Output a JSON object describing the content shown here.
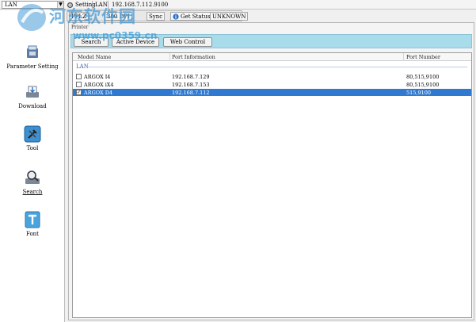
{
  "topbar": {
    "port_selected": "LAN",
    "setting_label": "Setting",
    "connection_type": "LAN",
    "ip_address": "192.168.7.112.9100"
  },
  "toolbar2": {
    "port_label": "PPLZ",
    "dpi_label": "300 DPI",
    "sync_label": "Sync",
    "get_status_label": "Get Status",
    "status_value": "UNKNOWN"
  },
  "sidebar": {
    "items": [
      {
        "label": "Parameter Setting",
        "icon": "parameter-setting-icon"
      },
      {
        "label": "Download",
        "icon": "download-icon"
      },
      {
        "label": "Tool",
        "icon": "tool-icon"
      },
      {
        "label": "Search",
        "icon": "search-icon"
      },
      {
        "label": "Font",
        "icon": "font-icon"
      }
    ]
  },
  "main": {
    "group_label": "Printer",
    "buttons": {
      "search": "Search",
      "active_device": "Active Device",
      "web_control": "Web Control"
    },
    "columns": [
      "Model Name",
      "Port Information",
      "Port Number"
    ],
    "group_header": "LAN",
    "rows": [
      {
        "model": "ARGOX I4",
        "port_info": "192.168.7.129",
        "port_number": "80,515,9100",
        "checked": "",
        "selected": false
      },
      {
        "model": "ARGOX iX4",
        "port_info": "192.168.7.153",
        "port_number": "80,515,9100",
        "checked": "",
        "selected": false
      },
      {
        "model": "ARGOX D4",
        "port_info": "192.168.7.112",
        "port_number": "515,9100",
        "checked": "✓",
        "selected": true
      }
    ]
  },
  "watermark": {
    "line1": "河东软件园",
    "line2": "www.pc0359.cn"
  },
  "colors": {
    "selection": "#2f7ad0",
    "button_bar": "#a9dcea",
    "group_header": "#3a5fa8"
  }
}
